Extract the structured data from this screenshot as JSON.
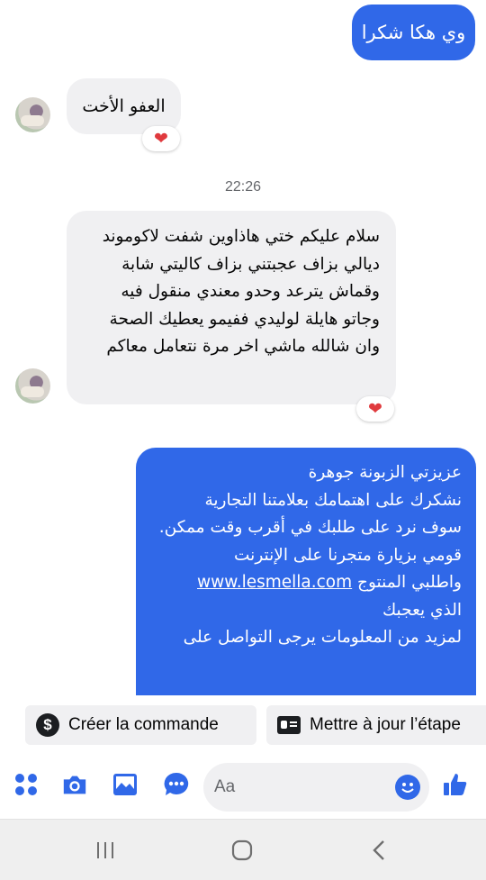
{
  "conversation": {
    "outgoing_top": "وي هكا شكرا",
    "incoming_1": "العفو الأخت",
    "reaction_1": "❤",
    "timestamp": "22:26",
    "incoming_2_lines": [
      "سلام عليكم  ختي هاذاوين شفت لاكوموند",
      "ديالي بزاف عجبتني بزاف  كاليتي شابة",
      "وقماش يترعد وحدو معندي منقول فيه",
      "وجاتو هايلة لوليدي ففيمو يعطيك الصحة",
      "وان شالله ماشي  اخر مرة نتعامل معاكم"
    ],
    "reaction_2": "❤",
    "outgoing_2": {
      "line1": "عزيزتي الزبونة جوهرة",
      "line2": "نشكرك على اهتمامك بعلامتنا التجارية",
      "line3": "سوف نرد على طلبك في أقرب وقت ممكن.",
      "line4": "قومي بزيارة متجرنا على الإنترنت",
      "link": "www.lesmella.com",
      "line5_after_link": "واطلبي المنتوج",
      "line6": "الذي يعجبك",
      "line7": "لمزيد من المعلومات يرجى التواصل على"
    }
  },
  "quick_actions": {
    "create_order": "Créer la commande",
    "update_stage": "Mettre à jour l’étape"
  },
  "composer": {
    "placeholder": "Aa"
  },
  "colors": {
    "accent": "#3068e8",
    "bubble_in": "#f0f0f2",
    "heart": "#e03a3e"
  },
  "icons": [
    "apps-icon",
    "camera-icon",
    "gallery-icon",
    "chat-more-icon",
    "emoji-icon",
    "thumbs-up-icon",
    "dollar-icon",
    "id-card-icon",
    "recent-apps-icon",
    "home-icon",
    "back-icon"
  ]
}
